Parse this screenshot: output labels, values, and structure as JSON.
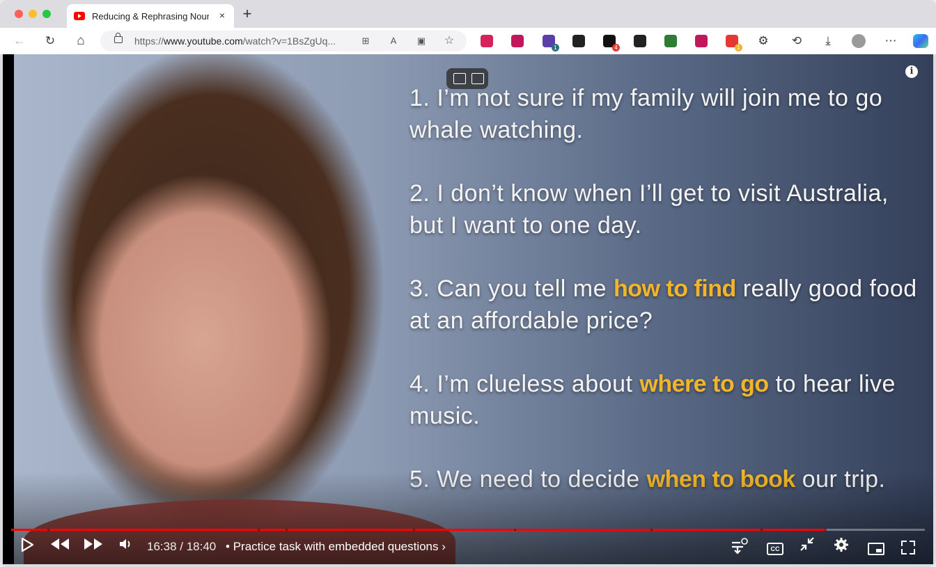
{
  "browser": {
    "tab": {
      "title": "Reducing & Rephrasing Noun C",
      "close_label": "×"
    },
    "new_tab_label": "+",
    "nav": {
      "back": "←",
      "reload": "↻",
      "home": "⌂"
    },
    "url": {
      "prefix": "https://",
      "domain": "www.youtube.com",
      "path": "/watch?v=1BsZgUq..."
    },
    "extensions": [
      {
        "name": "youtube-ext-icon",
        "color": "#d6215b",
        "badge": ""
      },
      {
        "name": "magnifier-ext-icon",
        "color": "#c2185b",
        "badge": ""
      },
      {
        "name": "puzzle-ext-icon",
        "color": "#5b3fa8",
        "badge": "1"
      },
      {
        "name": "cross-ext-icon",
        "color": "#222222",
        "badge": ""
      },
      {
        "name": "dark-ext-icon",
        "color": "#111111",
        "badge": "4"
      },
      {
        "name": "record-ext-icon",
        "color": "#222222",
        "badge": ""
      },
      {
        "name": "download-ext-icon",
        "color": "#2e7d32",
        "badge": ""
      },
      {
        "name": "trello-ext-icon",
        "color": "#c2185b",
        "badge": ""
      },
      {
        "name": "red-dot-ext-icon",
        "color": "#e53935",
        "badge": "1"
      }
    ]
  },
  "video": {
    "slide_lines": [
      {
        "num": "1.",
        "pre": "I’m not sure if my family will join me to go whale watching.",
        "hl": "",
        "post": ""
      },
      {
        "num": "2.",
        "pre": "I don’t know when I’ll get to visit Australia, but I want to one day.",
        "hl": "",
        "post": ""
      },
      {
        "num": "3.",
        "pre": "Can you tell me ",
        "hl": "how to find",
        "post": " really good food at an affordable price?"
      },
      {
        "num": "4.",
        "pre": "I’m clueless about ",
        "hl": "where to go",
        "post": " to hear live music."
      },
      {
        "num": "5.",
        "pre": "We need to decide ",
        "hl": "when to book",
        "post": " our trip."
      }
    ],
    "info_label": "i",
    "progress_fraction": 0.891,
    "current_time": "16:38",
    "duration": "18:40",
    "time_separator": " / ",
    "chapter_prefix": "•",
    "chapter_title": "Practice task with embedded questions",
    "chapter_chevron": "›",
    "cc_label": "CC",
    "accent_color": "#ff0000",
    "highlight_color": "#f2b52a"
  }
}
